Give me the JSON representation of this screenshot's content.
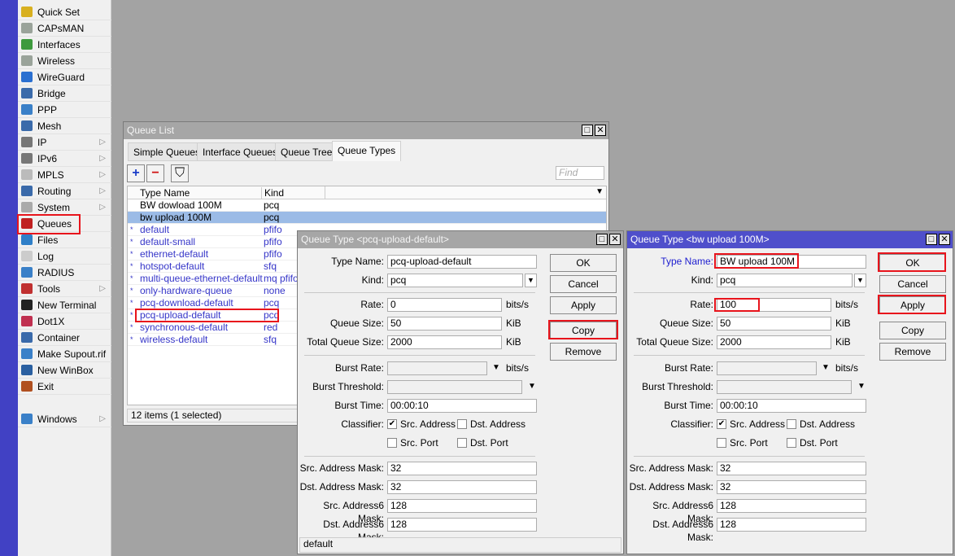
{
  "colors": {
    "sidebar_strip": "#4141c4",
    "active_title": "#4f4fcb",
    "inactive_title": "#a6a6a6",
    "highlight": "#e8141c",
    "selected_row": "#9bbbe6",
    "default_row_text": "#3535c8"
  },
  "sidebar": {
    "items": [
      {
        "label": "Quick Set",
        "icon": "magic-wand-icon",
        "color": "#d8b020"
      },
      {
        "label": "CAPsMAN",
        "icon": "antenna-icon",
        "color": "#9aa39a"
      },
      {
        "label": "Interfaces",
        "icon": "network-card-icon",
        "color": "#3d9a3d"
      },
      {
        "label": "Wireless",
        "icon": "wireless-icon",
        "color": "#9aa39a"
      },
      {
        "label": "WireGuard",
        "icon": "wireguard-icon",
        "color": "#2a6fd0"
      },
      {
        "label": "Bridge",
        "icon": "bridge-icon",
        "color": "#3a6aaa"
      },
      {
        "label": "PPP",
        "icon": "ppp-icon",
        "color": "#3a80c8"
      },
      {
        "label": "Mesh",
        "icon": "mesh-icon",
        "color": "#3a6aaa"
      },
      {
        "label": "IP",
        "icon": "ip-icon",
        "color": "#777",
        "submenu": true
      },
      {
        "label": "IPv6",
        "icon": "ipv6-icon",
        "color": "#777",
        "submenu": true
      },
      {
        "label": "MPLS",
        "icon": "mpls-icon",
        "color": "#bbb",
        "submenu": true
      },
      {
        "label": "Routing",
        "icon": "routing-icon",
        "color": "#3a6aaa",
        "submenu": true
      },
      {
        "label": "System",
        "icon": "gear-icon",
        "color": "#aaa",
        "submenu": true
      },
      {
        "label": "Queues",
        "icon": "queues-icon",
        "color": "#c02020"
      },
      {
        "label": "Files",
        "icon": "folder-icon",
        "color": "#2f7fc8"
      },
      {
        "label": "Log",
        "icon": "log-icon",
        "color": "#ccc"
      },
      {
        "label": "RADIUS",
        "icon": "radius-icon",
        "color": "#3a80c8"
      },
      {
        "label": "Tools",
        "icon": "tools-icon",
        "color": "#c03030",
        "submenu": true
      },
      {
        "label": "New Terminal",
        "icon": "terminal-icon",
        "color": "#222"
      },
      {
        "label": "Dot1X",
        "icon": "dot1x-icon",
        "color": "#c03050"
      },
      {
        "label": "Container",
        "icon": "container-icon",
        "color": "#3a6aaa"
      },
      {
        "label": "Make Supout.rif",
        "icon": "supout-icon",
        "color": "#3a80c8"
      },
      {
        "label": "New WinBox",
        "icon": "winbox-icon",
        "color": "#2a5fa0"
      },
      {
        "label": "Exit",
        "icon": "exit-icon",
        "color": "#b05020"
      },
      {
        "label": "Windows",
        "icon": "windows-icon",
        "color": "#3a80c8",
        "submenu": true
      }
    ]
  },
  "queue_list": {
    "title": "Queue List",
    "tabs": [
      "Simple Queues",
      "Interface Queues",
      "Queue Tree",
      "Queue Types"
    ],
    "active_tab": "Queue Types",
    "find_placeholder": "Find",
    "columns": [
      "Type Name",
      "Kind"
    ],
    "rows": [
      {
        "flag": "",
        "name": "BW dowload 100M",
        "kind": "pcq"
      },
      {
        "flag": "",
        "name": "bw upload 100M",
        "kind": "pcq",
        "selected": true
      },
      {
        "flag": "*",
        "name": "default",
        "kind": "pfifo"
      },
      {
        "flag": "*",
        "name": "default-small",
        "kind": "pfifo"
      },
      {
        "flag": "*",
        "name": "ethernet-default",
        "kind": "pfifo"
      },
      {
        "flag": "*",
        "name": "hotspot-default",
        "kind": "sfq"
      },
      {
        "flag": "*",
        "name": "multi-queue-ethernet-default",
        "kind": "mq pfifo"
      },
      {
        "flag": "*",
        "name": "only-hardware-queue",
        "kind": "none"
      },
      {
        "flag": "*",
        "name": "pcq-download-default",
        "kind": "pcq"
      },
      {
        "flag": "*",
        "name": "pcq-upload-default",
        "kind": "pcq"
      },
      {
        "flag": "*",
        "name": "synchronous-default",
        "kind": "red"
      },
      {
        "flag": "*",
        "name": "wireless-default",
        "kind": "sfq"
      }
    ],
    "status": "12 items (1 selected)"
  },
  "labels": {
    "type_name": "Type Name:",
    "kind": "Kind:",
    "rate": "Rate:",
    "queue_size": "Queue Size:",
    "total_queue_size": "Total Queue Size:",
    "burst_rate": "Burst Rate:",
    "burst_threshold": "Burst Threshold:",
    "burst_time": "Burst Time:",
    "classifier": "Classifier:",
    "src_address": "Src. Address",
    "dst_address": "Dst. Address",
    "src_port": "Src. Port",
    "dst_port": "Dst. Port",
    "src_mask": "Src. Address Mask:",
    "dst_mask": "Dst. Address Mask:",
    "src6_mask": "Src. Address6 Mask:",
    "dst6_mask": "Dst. Address6 Mask:",
    "bits": "bits/s",
    "kib": "KiB",
    "ok": "OK",
    "cancel": "Cancel",
    "apply": "Apply",
    "copy": "Copy",
    "remove": "Remove"
  },
  "dialogs": [
    {
      "title": "Queue Type <pcq-upload-default>",
      "type_name": "pcq-upload-default",
      "kind": "pcq",
      "rate": "0",
      "queue_size": "50",
      "total_queue_size": "2000",
      "burst_rate": "",
      "burst_threshold": "",
      "burst_time": "00:00:10",
      "src_address": true,
      "dst_address": false,
      "src_port": false,
      "dst_port": false,
      "src_mask": "32",
      "dst_mask": "32",
      "src6_mask": "128",
      "dst6_mask": "128",
      "status": "default"
    },
    {
      "title": "Queue Type <bw upload 100M>",
      "type_name": "BW upload 100M",
      "kind": "pcq",
      "rate": "100",
      "queue_size": "50",
      "total_queue_size": "2000",
      "burst_rate": "",
      "burst_threshold": "",
      "burst_time": "00:00:10",
      "src_address": true,
      "dst_address": false,
      "src_port": false,
      "dst_port": false,
      "src_mask": "32",
      "dst_mask": "32",
      "src6_mask": "128",
      "dst6_mask": "128",
      "status": ""
    }
  ]
}
